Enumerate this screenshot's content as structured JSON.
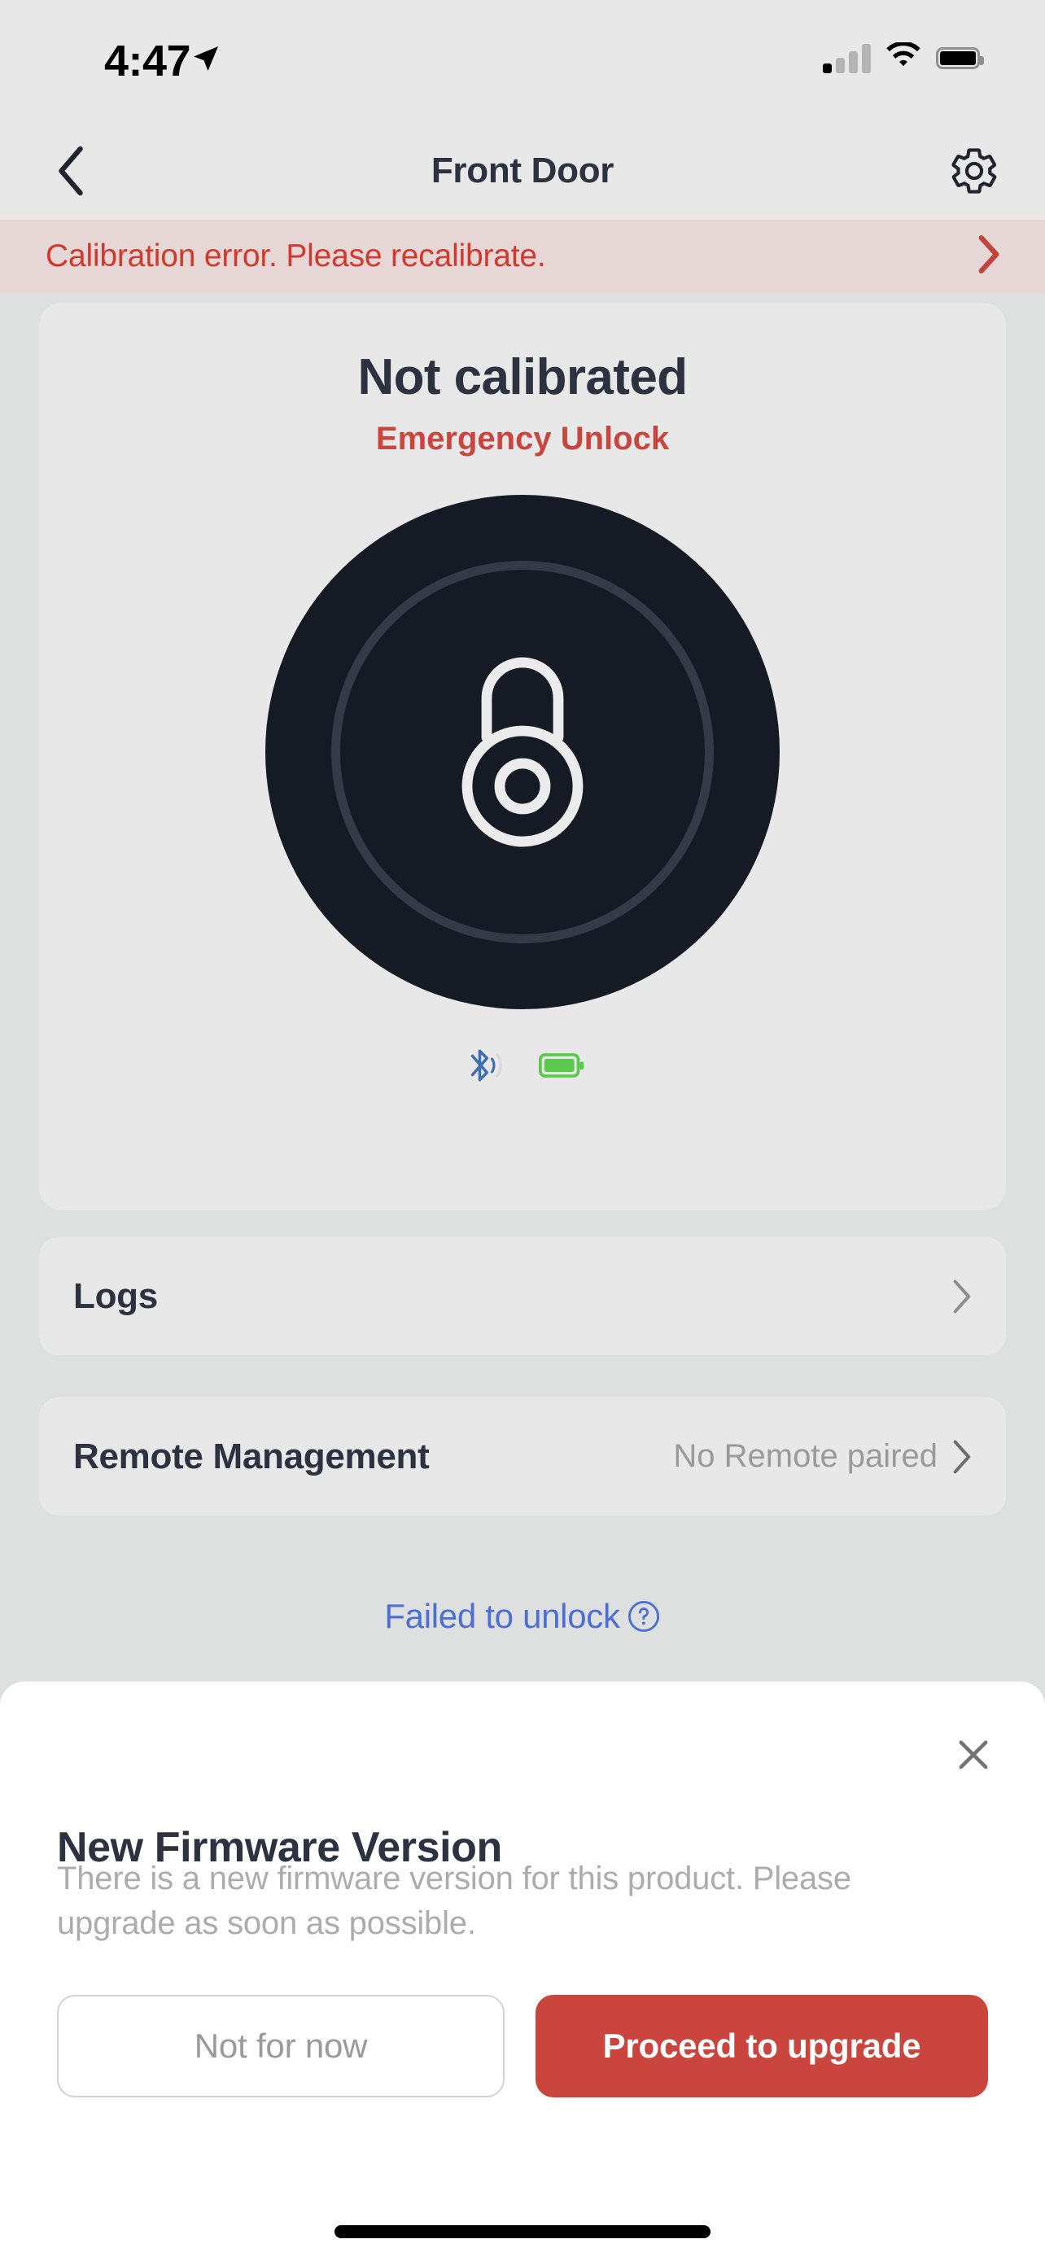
{
  "status_bar": {
    "time": "4:47",
    "location_icon": "location-arrow-icon",
    "cellular_icon": "cellular-signal-icon",
    "cellular_bars_filled": 1,
    "cellular_bars_total": 4,
    "wifi_icon": "wifi-icon",
    "battery_icon": "battery-icon"
  },
  "nav_bar": {
    "back_icon": "chevron-left-icon",
    "title": "Front Door",
    "settings_icon": "gear-icon"
  },
  "error_banner": {
    "message": "Calibration error. Please recalibrate.",
    "arrow_icon": "chevron-right-icon",
    "text_color": "#D0392C",
    "background_color": "#E6D6D5"
  },
  "lock_card": {
    "status": "Not calibrated",
    "action_label": "Emergency Unlock",
    "action_color": "#C9453E",
    "lock_icon": "padlock-icon",
    "knob_color": "#151A24",
    "bluetooth_icon": "bluetooth-icon",
    "bluetooth_color": "#3E6EB4",
    "battery_icon": "battery-full-icon",
    "battery_color": "#5BC94B"
  },
  "rows": [
    {
      "label": "Logs",
      "value": "",
      "chevron_icon": "chevron-right-icon"
    },
    {
      "label": "Remote Management",
      "value": "No Remote paired",
      "chevron_icon": "chevron-right-icon"
    }
  ],
  "failed_link": {
    "label": "Failed to unlock",
    "help_icon": "question-circle-icon",
    "color": "#4C6FD6"
  },
  "sheet": {
    "close_icon": "close-icon",
    "title": "New Firmware Version",
    "body": "There is a new firmware version for this product. Please upgrade as soon as possible.",
    "secondary_button": "Not for now",
    "primary_button": "Proceed to upgrade",
    "primary_color": "#C9453E"
  }
}
